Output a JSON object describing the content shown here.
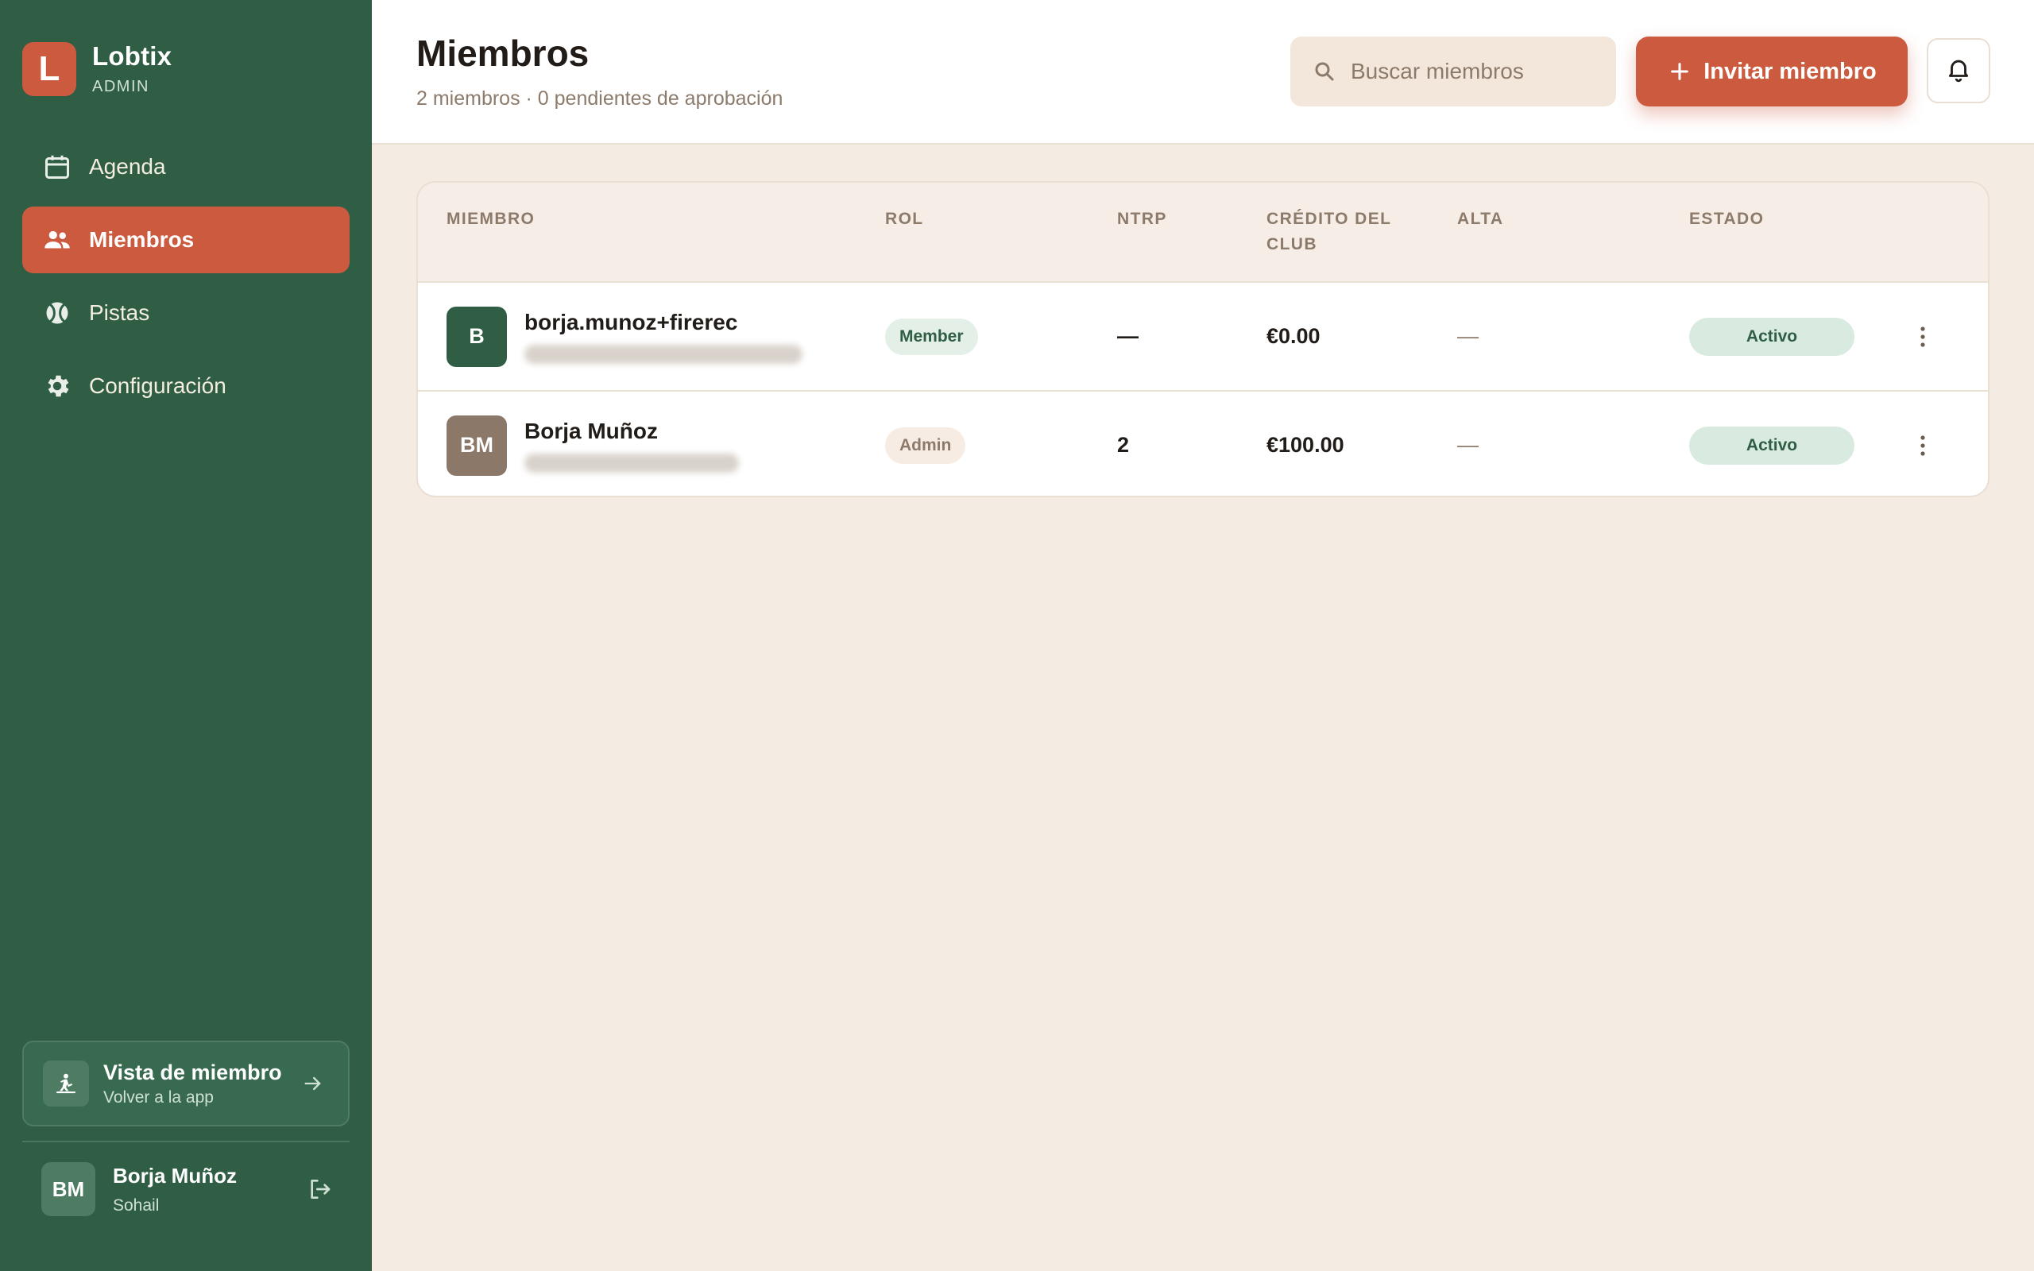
{
  "brand": {
    "initial": "L",
    "name": "Lobtix",
    "role": "ADMIN",
    "color": "#cc5a3f"
  },
  "sidebar": {
    "items": [
      {
        "label": "Agenda",
        "icon": "calendar-icon",
        "active": false
      },
      {
        "label": "Miembros",
        "icon": "people-icon",
        "active": true
      },
      {
        "label": "Pistas",
        "icon": "ball-icon",
        "active": false
      },
      {
        "label": "Configuración",
        "icon": "gear-icon",
        "active": false
      }
    ],
    "member_view": {
      "title": "Vista de miembro",
      "subtitle": "Volver a la app",
      "icon": "player-icon"
    },
    "user": {
      "initials": "BM",
      "name": "Borja Muñoz",
      "subtitle": "Sohail"
    }
  },
  "header": {
    "title": "Miembros",
    "subtitle": "2 miembros · 0 pendientes de aprobación",
    "search": {
      "placeholder": "Buscar miembros",
      "value": ""
    },
    "invite_label": "Invitar miembro"
  },
  "table": {
    "columns": [
      "Miembro",
      "Rol",
      "NTRP",
      "Crédito del club",
      "Alta",
      "Estado"
    ],
    "rows": [
      {
        "initials": "B",
        "avatar_color": "#2f5e45",
        "name": "borja.munoz+firerec",
        "role": "Member",
        "ntrp": "—",
        "credit": "€0.00",
        "joined": "—",
        "status": "Activo"
      },
      {
        "initials": "BM",
        "avatar_color": "#8b7868",
        "name": "Borja Muñoz",
        "role": "Admin",
        "ntrp": "2",
        "credit": "€100.00",
        "joined": "—",
        "status": "Activo"
      }
    ]
  },
  "colors": {
    "sidebar": "#2f5e45",
    "accent": "#cc5a3f",
    "background": "#f4ebe2",
    "status_active_bg": "#d9ebe1"
  }
}
